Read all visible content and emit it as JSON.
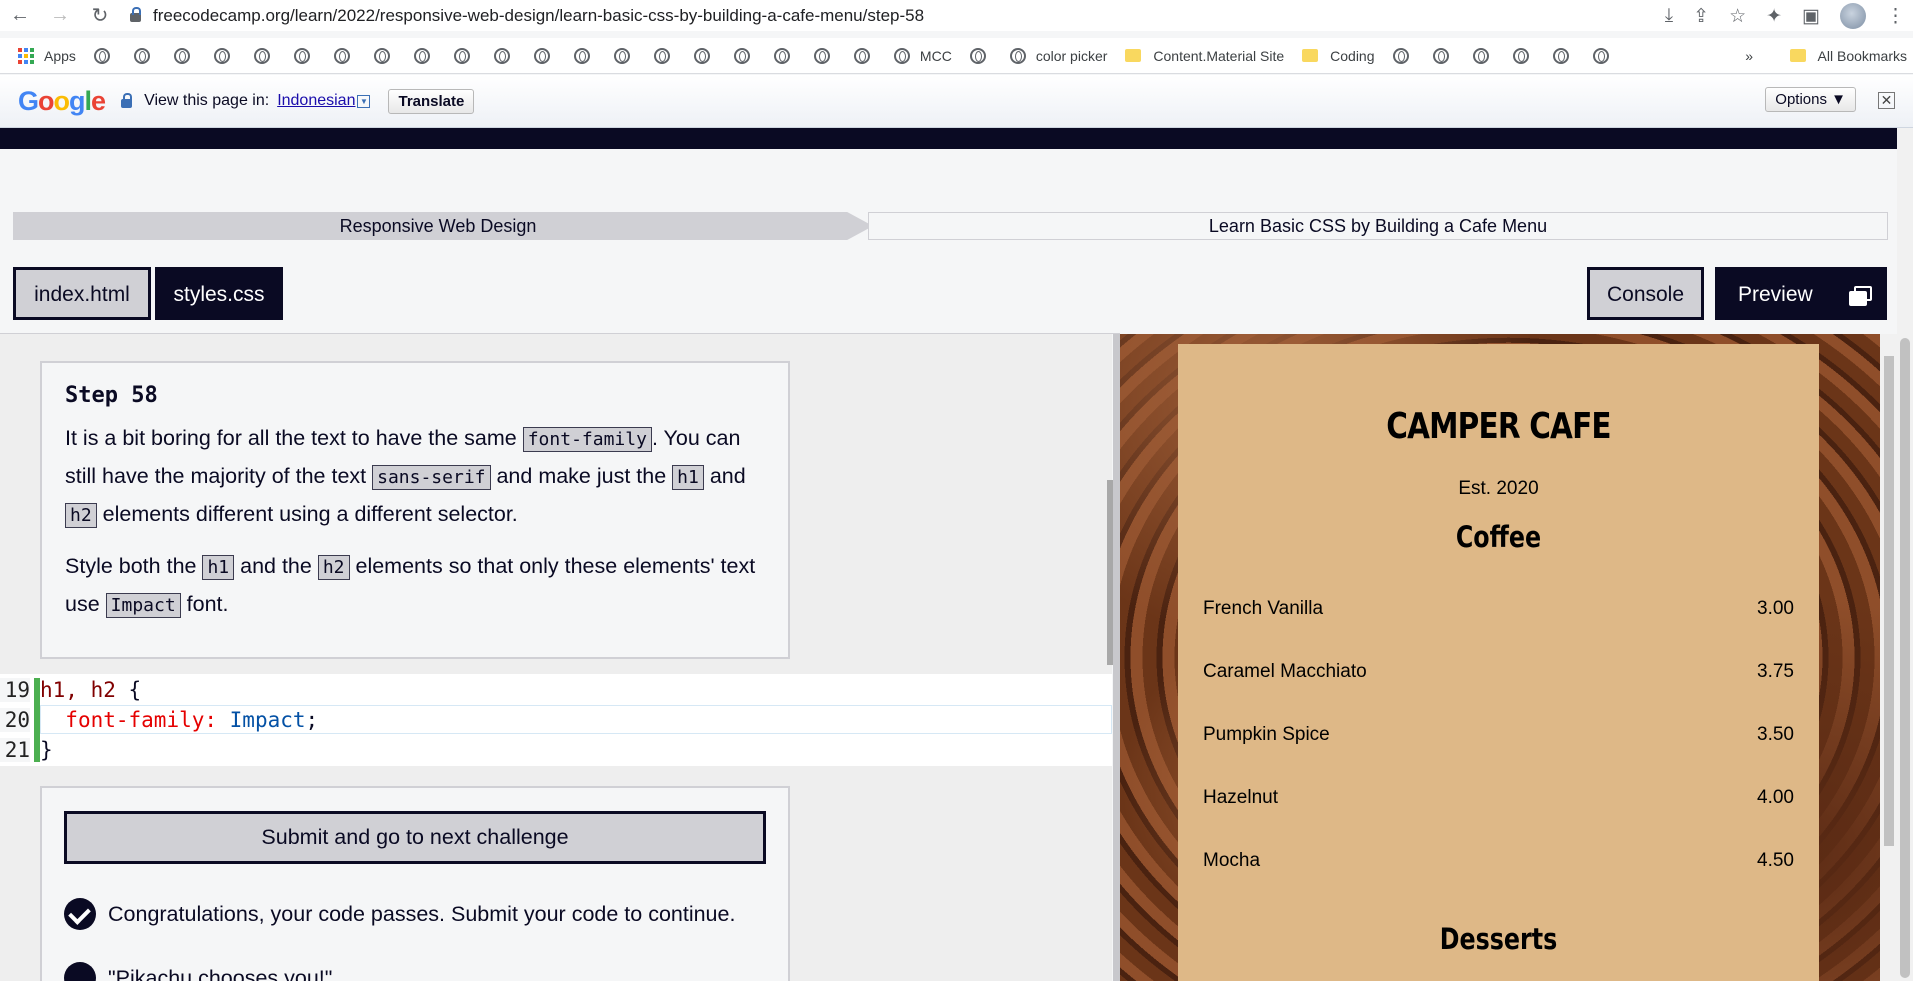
{
  "browser": {
    "url": "freecodecamp.org/learn/2022/responsive-web-design/learn-basic-css-by-building-a-cafe-menu/step-58",
    "bookmarks": {
      "apps_label": "Apps",
      "mcc_label": "MCC",
      "color_picker_label": "color picker",
      "material_label": "Content.Material Site",
      "coding_label": "Coding",
      "more_label": "»",
      "all_bookmarks_label": "All Bookmarks"
    }
  },
  "translate_bar": {
    "view_text": "View this page in:",
    "language": "Indonesian",
    "translate_label": "Translate",
    "options_label": "Options ▼",
    "close_label": "✕"
  },
  "breadcrumb": {
    "first": "Responsive Web Design",
    "second": "Learn Basic CSS by Building a Cafe Menu"
  },
  "tabs": {
    "index": "index.html",
    "styles": "styles.css",
    "console": "Console",
    "preview": "Preview"
  },
  "step": {
    "title": "Step 58",
    "p1_a": "It is a bit boring for all the text to have the same ",
    "p1_code1": "font-family",
    "p1_b": ". You can still have the majority of the text ",
    "p1_code2": "sans-serif",
    "p1_c": " and make just the ",
    "p1_code3": "h1",
    "p1_d": " and ",
    "p1_code4": "h2",
    "p1_e": " elements different using a different selector.",
    "p2_a": "Style both the ",
    "p2_code1": "h1",
    "p2_b": " and the ",
    "p2_code2": "h2",
    "p2_c": " elements so that only these elements' text use ",
    "p2_code3": "Impact",
    "p2_d": " font."
  },
  "editor": {
    "line_numbers": [
      "19",
      "20",
      "21"
    ],
    "line1_selector": "h1, h2",
    "line1_brace": " {",
    "line2_prop": "font-family:",
    "line2_val": " Impact",
    "line2_semi": ";",
    "line3": "}"
  },
  "submit": {
    "button_label": "Submit and go to next challenge",
    "congrats": "Congratulations, your code passes. Submit your code to continue.",
    "pika": "\"Pikachu chooses you!\""
  },
  "preview": {
    "title": "CAMPER CAFE",
    "est": "Est. 2020",
    "coffee_heading": "Coffee",
    "items": [
      {
        "name": "French Vanilla",
        "price": "3.00"
      },
      {
        "name": "Caramel Macchiato",
        "price": "3.75"
      },
      {
        "name": "Pumpkin Spice",
        "price": "3.50"
      },
      {
        "name": "Hazelnut",
        "price": "4.00"
      },
      {
        "name": "Mocha",
        "price": "4.50"
      }
    ],
    "desserts_heading": "Desserts"
  },
  "colors": {
    "fcc_dark": "#0a0a23",
    "fcc_gray": "#d0d0d5",
    "menu_bg": "#deb887",
    "gutter_green": "#4caf50"
  }
}
